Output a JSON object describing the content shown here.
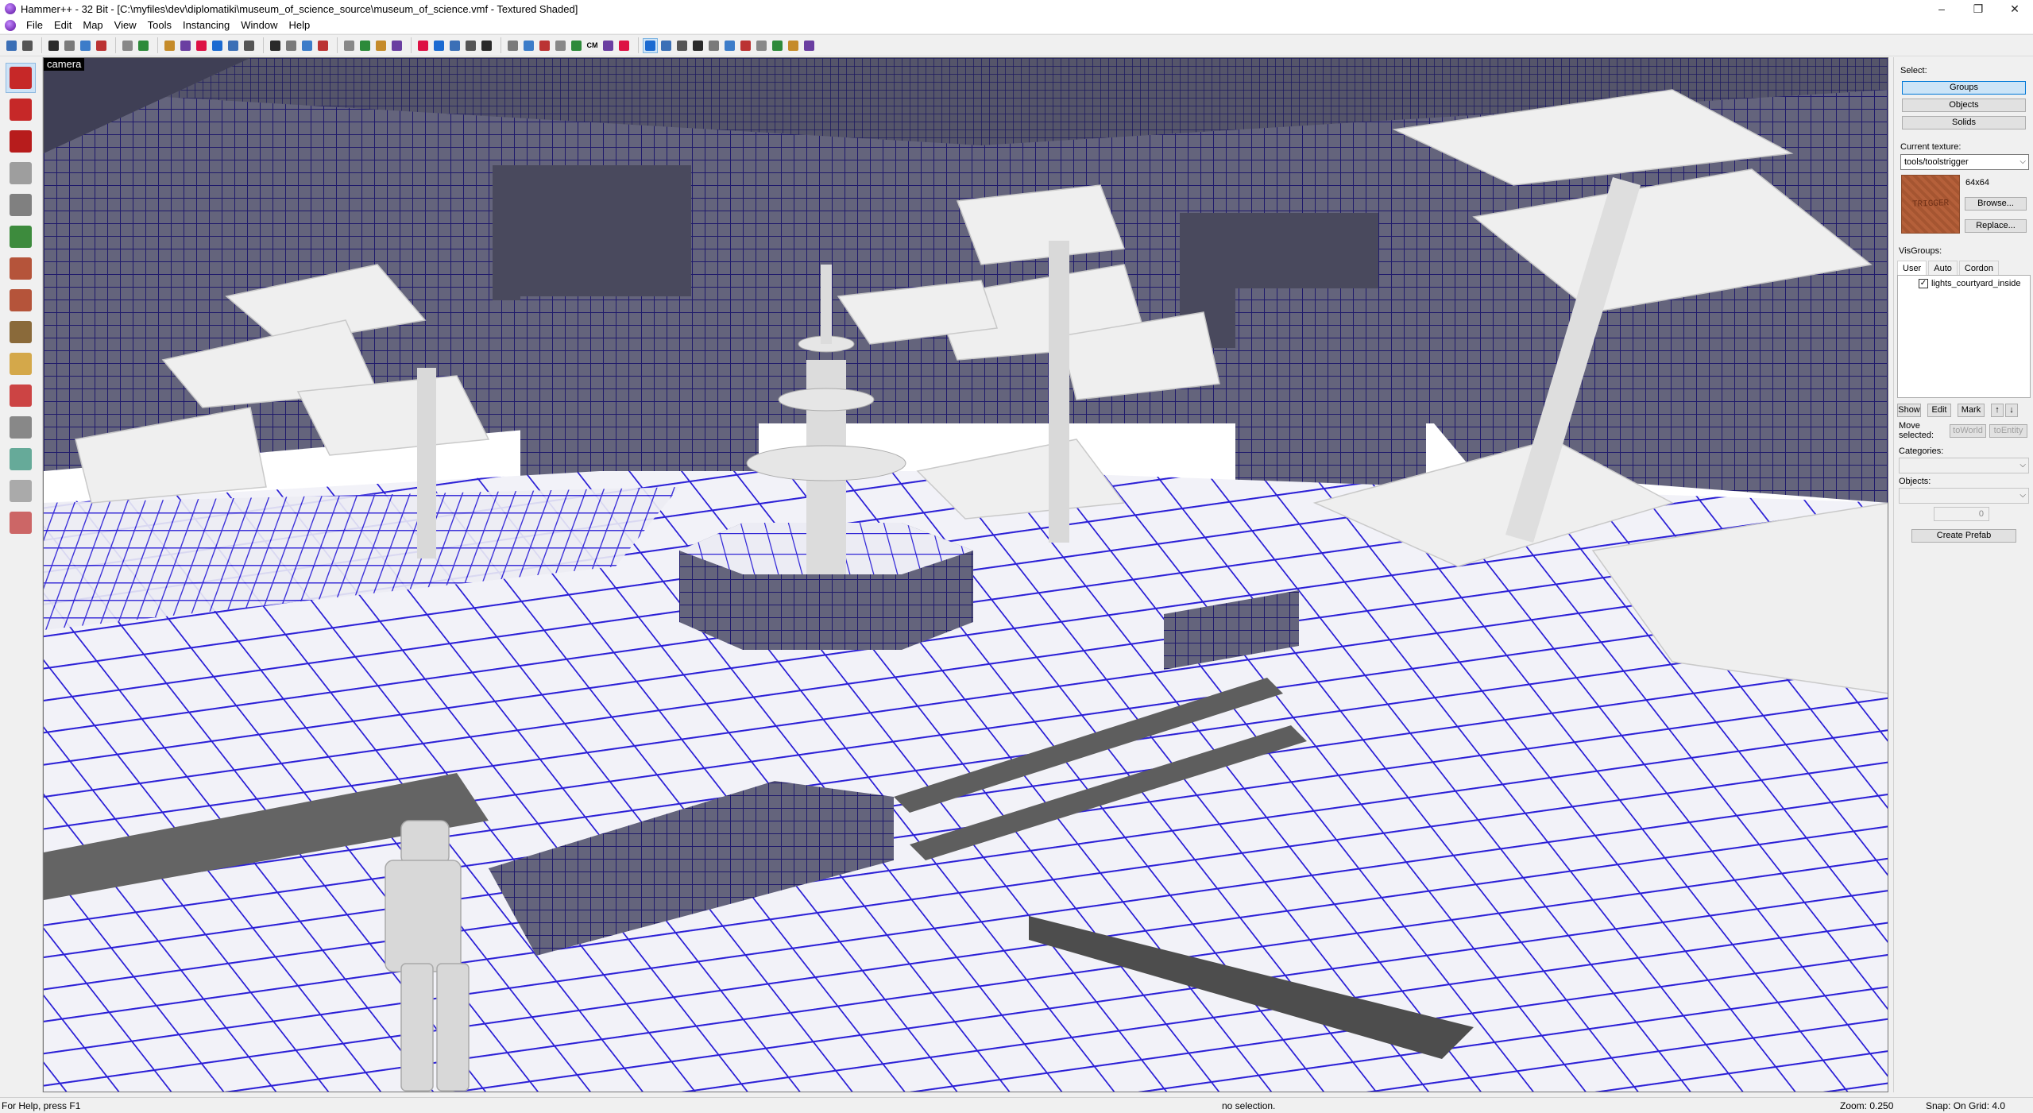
{
  "window": {
    "title": "Hammer++ - 32 Bit - [C:\\myfiles\\dev\\diplomatiki\\museum_of_science_source\\museum_of_science.vmf - Textured Shaded]",
    "controls": {
      "minimize": "–",
      "restore": "❐",
      "close": "✕"
    }
  },
  "menu": {
    "items": [
      "File",
      "Edit",
      "Map",
      "View",
      "Tools",
      "Instancing",
      "Window",
      "Help"
    ]
  },
  "toolbar": {
    "icons": [
      "grid-icon",
      "grid-toggle-icon",
      "3d-grid-icon",
      "box-icon",
      "toggle-group-icon",
      "toggle-group2-icon",
      "undo-icon",
      "redo-icon",
      "carve-icon",
      "hollow-icon",
      "group-icon",
      "ungroup-icon",
      "tie-entity-icon",
      "move-to-world-icon",
      "hide-icon",
      "show-icon",
      "texture-lock-icon",
      "scale-lock-icon",
      "cordon-icon",
      "texture-app-icon",
      "decal-icon",
      "overlay-icon",
      "clip-icon",
      "vertex-icon",
      "run-map-icon",
      "entity-report-icon",
      "check-problems-icon",
      "compile-icon",
      "sprite-icon",
      "model-icon",
      "helper-icon",
      "lighting-icon",
      "cm-icon",
      "light-preview-icon",
      "color-icon",
      "select-icon",
      "drag-icon",
      "vertex-select-icon",
      "displacement-icon",
      "instance-icon",
      "autovis-icon",
      "target-icon",
      "origin-icon",
      "plus-icon",
      "hint-icon",
      "node-icon"
    ],
    "cm_label": "CM"
  },
  "lefttools": {
    "icons": [
      "selection-tool-icon",
      "magnify-tool-icon",
      "camera-tool-icon",
      "entity-tool-icon",
      "block-tool-icon",
      "texture-app-tool-icon",
      "apply-texture-icon",
      "apply-decal-icon",
      "apply-overlay-icon",
      "clipping-tool-icon",
      "vertex-tool-icon",
      "path-tool-icon",
      "sound-tool-icon",
      "cordon-tool-icon",
      "prefab-tool-icon"
    ]
  },
  "viewport": {
    "label": "camera"
  },
  "rightpanel": {
    "select_label": "Select:",
    "select_buttons": [
      "Groups",
      "Objects",
      "Solids"
    ],
    "current_texture_label": "Current texture:",
    "current_texture": "tools/toolstrigger",
    "texture_size": "64x64",
    "texture_preview_text": "TRIGGER",
    "browse_button": "Browse...",
    "replace_button": "Replace...",
    "visgroups_label": "VisGroups:",
    "visgroup_tabs": [
      "User",
      "Auto",
      "Cordon"
    ],
    "visgroup_items": [
      {
        "name": "lights_courtyard_inside",
        "checked": true
      }
    ],
    "vg_buttons": [
      "Show",
      "Edit",
      "Mark"
    ],
    "move_selected_label": "Move selected:",
    "to_world": "toWorld",
    "to_entity": "toEntity",
    "categories_label": "Categories:",
    "objects_label": "Objects:",
    "spinner_value": "0",
    "create_prefab": "Create Prefab"
  },
  "status": {
    "help": "For Help, press F1",
    "selection": "no selection.",
    "zoom": "Zoom: 0.250",
    "snap": "Snap: On Grid: 4.0"
  },
  "colors": {
    "grid_line": "#2b1fd6",
    "wall": "#5a5a72",
    "foliage": "#ececec"
  }
}
